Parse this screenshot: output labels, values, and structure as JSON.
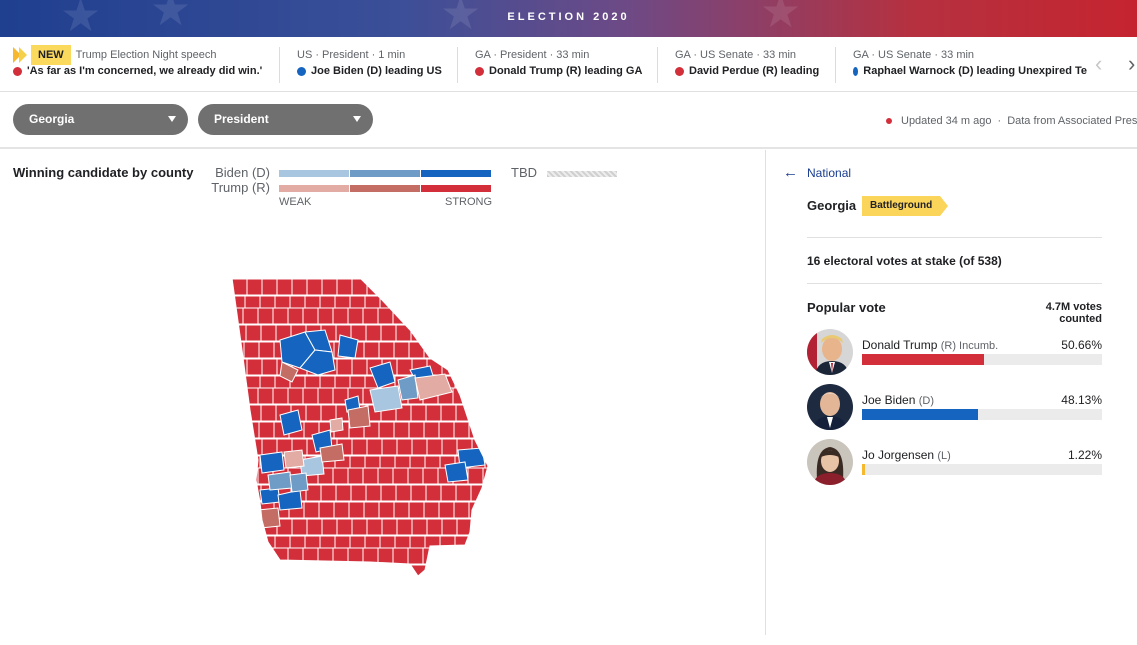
{
  "banner": {
    "title": "ELECTION 2020"
  },
  "ticker": {
    "items": [
      {
        "badge": "NEW",
        "top": "Trump Election Night speech",
        "bottom": "'As far as I'm concerned, we already did win.'",
        "party": "r"
      },
      {
        "top": "US · President · 1 min",
        "bottom": "Joe Biden (D) leading US",
        "party": "b"
      },
      {
        "top": "GA · President · 33 min",
        "bottom": "Donald Trump (R) leading GA",
        "party": "r"
      },
      {
        "top": "GA · US Senate · 33 min",
        "bottom": "David Perdue (R) leading",
        "party": "r"
      },
      {
        "top": "GA · US Senate · 33 min",
        "bottom": "Raphael Warnock (D) leading Unexpired Te",
        "party": "b"
      }
    ],
    "prev_icon": "chevron-left-icon",
    "next_icon": "chevron-right-icon"
  },
  "filters": {
    "state": "Georgia",
    "race": "President",
    "updated": "Updated 34 m ago",
    "source": "Data from Associated Press"
  },
  "map": {
    "heading": "Winning candidate by county",
    "legend_biden": "Biden (D)",
    "legend_trump": "Trump (R)",
    "weak": "WEAK",
    "strong": "STRONG",
    "tbd": "TBD",
    "colors": {
      "biden": [
        "#a9c6e0",
        "#6e9cc6",
        "#1565c0"
      ],
      "trump": [
        "#e2aba3",
        "#c36d64",
        "#d32f3a"
      ]
    }
  },
  "sidebar": {
    "back_label": "National",
    "state_name": "Georgia",
    "badge": "Battleground",
    "electoral": "16 electoral votes at stake (of 538)",
    "popular_title": "Popular vote",
    "votes_counted": "4.7M votes counted",
    "candidates": [
      {
        "name": "Donald Trump",
        "party": "(R) Incumb.",
        "pct_label": "50.66%",
        "pct": 50.66,
        "color": "#d32f3a"
      },
      {
        "name": "Joe Biden",
        "party": "(D)",
        "pct_label": "48.13%",
        "pct": 48.13,
        "color": "#1565c0"
      },
      {
        "name": "Jo Jorgensen",
        "party": "(L)",
        "pct_label": "1.22%",
        "pct": 1.22,
        "color": "#f5b82e"
      }
    ]
  }
}
